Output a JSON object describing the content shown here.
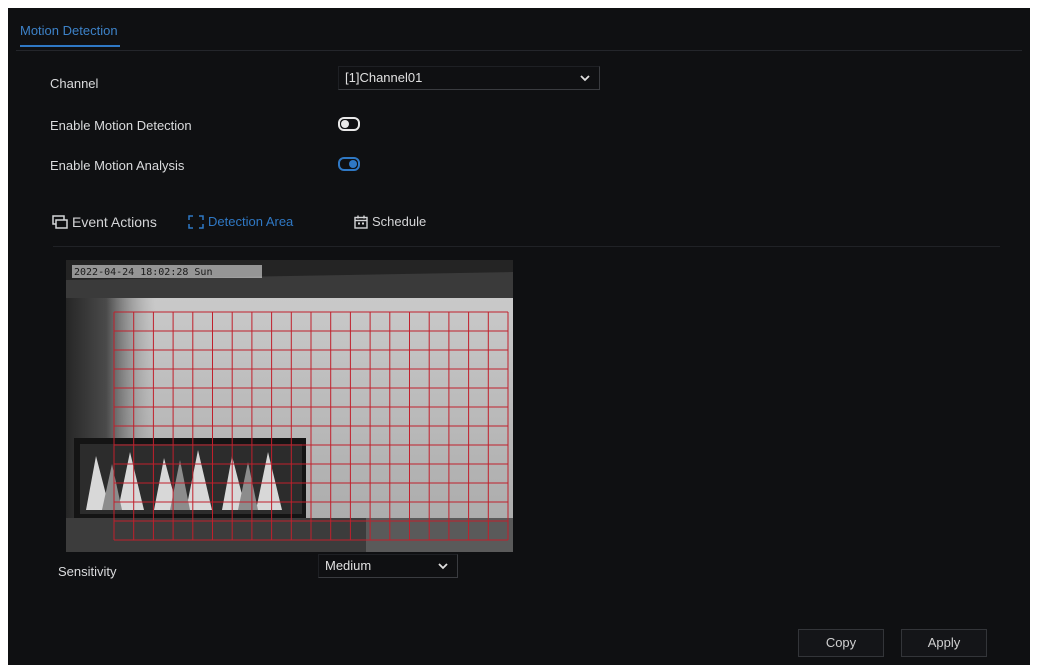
{
  "header": {
    "tab_label": "Motion Detection"
  },
  "form": {
    "channel_label": "Channel",
    "channel_value": "[1]Channel01",
    "enable_motion_detection_label": "Enable Motion Detection",
    "enable_motion_detection_on": false,
    "enable_motion_analysis_label": "Enable Motion Analysis",
    "enable_motion_analysis_on": true
  },
  "subtabs": [
    {
      "label": "Event Actions",
      "icon": "event-actions-icon",
      "active": false
    },
    {
      "label": "Detection Area",
      "icon": "detection-area-icon",
      "active": true
    },
    {
      "label": "Schedule",
      "icon": "calendar-icon",
      "active": false
    }
  ],
  "video": {
    "timestamp": "2022-04-24 18:02:28 Sun"
  },
  "sensitivity": {
    "label": "Sensitivity",
    "value": "Medium"
  },
  "buttons": {
    "copy": "Copy",
    "apply": "Apply"
  },
  "colors": {
    "accent": "#2f78c4",
    "grid_line": "#c0202c",
    "background": "#0f1012"
  }
}
